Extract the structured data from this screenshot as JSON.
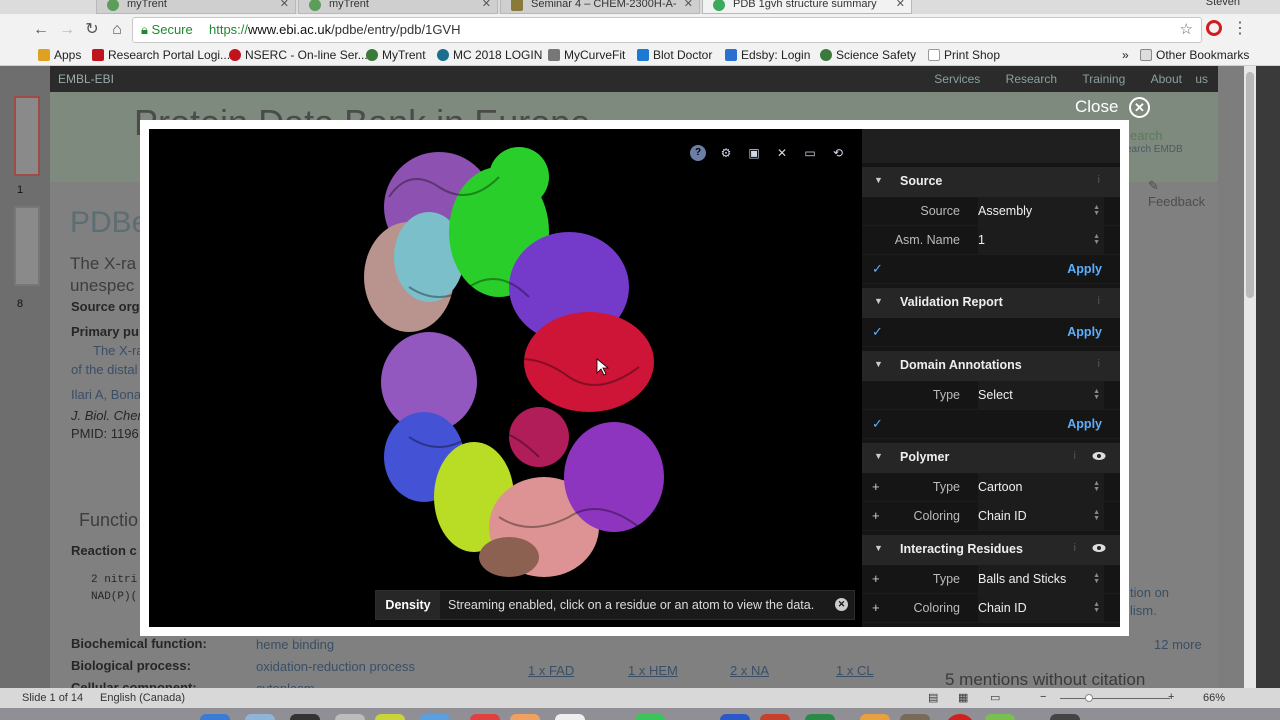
{
  "browser": {
    "tabs": [
      {
        "label": "myTrent"
      },
      {
        "label": "myTrent"
      },
      {
        "label": "Seminar 4 – CHEM-2300H-A-"
      },
      {
        "label": "PDB 1gvh structure summary"
      }
    ],
    "profile": "Steven",
    "secure_label": "Secure",
    "url_prefix": "https://",
    "url_host": "www.ebi.ac.uk",
    "url_path": "/pdbe/entry/pdb/1GVH",
    "bookmarks": [
      {
        "label": "Apps",
        "color": "#e0a020"
      },
      {
        "label": "Research Portal Logi...",
        "color": "#c0141c"
      },
      {
        "label": "NSERC - On-line Ser...",
        "color": "#c0141c"
      },
      {
        "label": "MyTrent",
        "color": "#3b7a3b"
      },
      {
        "label": "MC 2018 LOGIN",
        "color": "#1a6f8f"
      },
      {
        "label": "MyCurveFit",
        "color": "#777777"
      },
      {
        "label": "Blot Doctor",
        "color": "#1a7ad4"
      },
      {
        "label": "Edsby: Login",
        "color": "#2b6fd1"
      },
      {
        "label": "Science Safety",
        "color": "#3b7a3b"
      },
      {
        "label": "Print Shop",
        "color": "#999999"
      }
    ],
    "other_bookmarks": "Other Bookmarks"
  },
  "background_page": {
    "ebi_logo": "EMBL-EBI",
    "ebi_links": [
      "Services",
      "Research",
      "Training",
      "About us"
    ],
    "pdbe_title": "Protein Data Bank in Europe",
    "pdbe_big": "PDBe",
    "fragments": {
      "xray": "The X-ra",
      "unesp": "unespec",
      "source_org": "Source org",
      "primary_pub": "Primary pu",
      "the_x": "The X-ra",
      "of_distal": "of the distal",
      "authors": "Ilari A, Bona",
      "journal": "J. Biol. Chem",
      "pmid": "PMID: 1196",
      "function": "Functio",
      "reaction": "Reaction c",
      "code1": "2 nitri",
      "code2": "NAD(P)(",
      "biochem_label": "Biochemical function:",
      "biochem_value": "heme binding",
      "bioprocess_label": "Biological process:",
      "bioprocess_value": "oxidation-reduction process",
      "cellcomp_label": "Cellular component:",
      "cellcomp_value": "cytoplasm",
      "ligand1": "1 x FAD",
      "ligand2": "1 x HEM",
      "ligand3": "2 x NA",
      "ligand4": "1 x CL",
      "more": "12 more",
      "mentions": "5 mentions without citation",
      "search": "earch",
      "search_emdb": "earch EMDB",
      "feedback": "Feedback",
      "side1": "tion on",
      "side2": "lism."
    }
  },
  "overlay": {
    "close_label": "Close"
  },
  "viewer": {
    "density_label": "Density",
    "density_text": "Streaming enabled, click on a residue or an atom to view the data."
  },
  "panel": {
    "source": {
      "title": "Source",
      "source_label": "Source",
      "source_value": "Assembly",
      "asm_label": "Asm. Name",
      "asm_value": "1",
      "apply": "Apply"
    },
    "validation": {
      "title": "Validation Report",
      "apply": "Apply"
    },
    "domain": {
      "title": "Domain Annotations",
      "type_label": "Type",
      "type_value": "Select",
      "apply": "Apply"
    },
    "polymer": {
      "title": "Polymer",
      "type_label": "Type",
      "type_value": "Cartoon",
      "coloring_label": "Coloring",
      "coloring_value": "Chain ID"
    },
    "interacting": {
      "title": "Interacting Residues",
      "type_label": "Type",
      "type_value": "Balls and Sticks",
      "coloring_label": "Coloring",
      "coloring_value": "Chain ID"
    }
  },
  "statusbar": {
    "slide_info": "Slide 1 of 14",
    "language": "English (Canada)",
    "zoom": "66%"
  }
}
